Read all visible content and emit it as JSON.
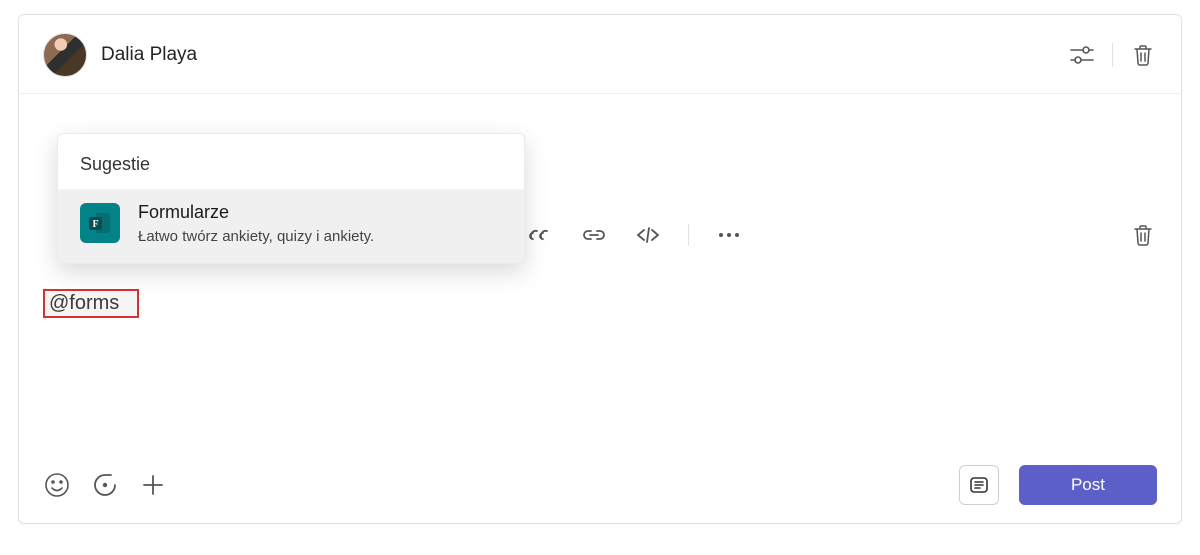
{
  "header": {
    "user_name": "Dalia Playa"
  },
  "suggestions": {
    "title": "Sugestie",
    "items": [
      {
        "name": "Formularze",
        "desc": "Łatwo twórz ankiety, quizy i ankiety."
      }
    ]
  },
  "editor": {
    "mention_text": "@forms"
  },
  "footer": {
    "post_label": "Post"
  }
}
